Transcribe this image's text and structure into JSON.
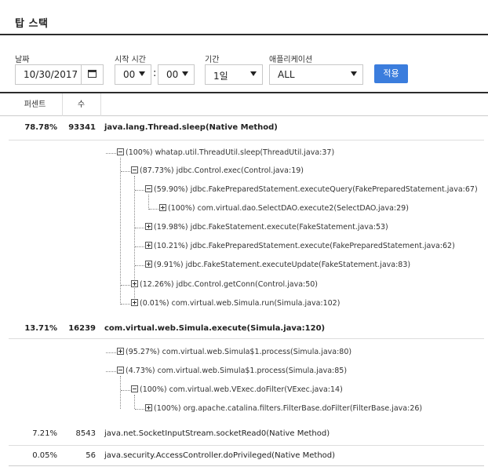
{
  "header": {
    "title": "탑 스택"
  },
  "filters": {
    "date_label": "날짜",
    "date_value": "10/30/2017",
    "start_time_label": "시작 시간",
    "hour_value": "00",
    "minute_value": "00",
    "period_label": "기간",
    "period_value": "1일",
    "app_label": "애플리케이션",
    "app_value": "ALL",
    "apply_label": "적용"
  },
  "table": {
    "col_percent": "퍼센트",
    "col_count": "수",
    "rows": [
      {
        "percent": "78.78%",
        "count": "93341",
        "method": "java.lang.Thread.sleep(Native Method)",
        "tree": [
          "(100%) whatap.util.ThreadUtil.sleep(ThreadUtil.java:37)",
          "(87.73%) jdbc.Control.exec(Control.java:19)",
          "(59.90%) jdbc.FakePreparedStatement.executeQuery(FakePreparedStatement.java:67)",
          "(100%) com.virtual.dao.SelectDAO.execute2(SelectDAO.java:29)",
          "(19.98%) jdbc.FakeStatement.execute(FakeStatement.java:53)",
          "(10.21%) jdbc.FakePreparedStatement.execute(FakePreparedStatement.java:62)",
          "(9.91%) jdbc.FakeStatement.executeUpdate(FakeStatement.java:83)",
          "(12.26%) jdbc.Control.getConn(Control.java:50)",
          "(0.01%) com.virtual.web.Simula.run(Simula.java:102)"
        ]
      },
      {
        "percent": "13.71%",
        "count": "16239",
        "method": "com.virtual.web.Simula.execute(Simula.java:120)",
        "tree": [
          "(95.27%) com.virtual.web.Simula$1.process(Simula.java:80)",
          "(4.73%) com.virtual.web.Simula$1.process(Simula.java:85)",
          "(100%) com.virtual.web.VExec.doFilter(VExec.java:14)",
          "(100%) org.apache.catalina.filters.FilterBase.doFilter(FilterBase.java:26)"
        ]
      },
      {
        "percent": "7.21%",
        "count": "8543",
        "method": "java.net.SocketInputStream.socketRead0(Native Method)"
      },
      {
        "percent": "0.05%",
        "count": "56",
        "method": "java.security.AccessController.doPrivileged(Native Method)"
      }
    ]
  }
}
